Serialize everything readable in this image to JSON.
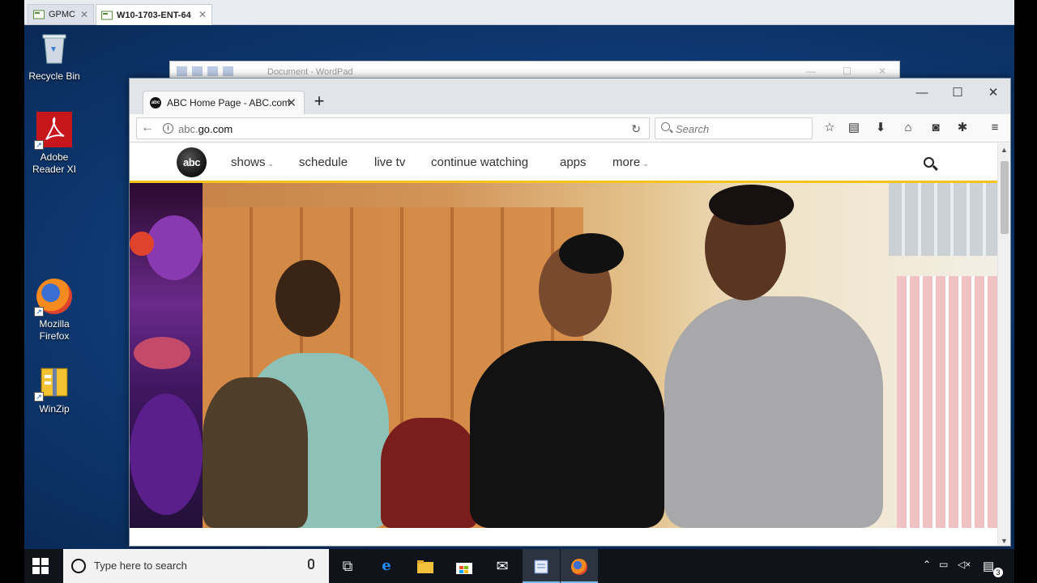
{
  "host_tabs": [
    {
      "label": "GPMC",
      "close": "✕"
    },
    {
      "label": "W10-1703-ENT-64",
      "close": "✕"
    }
  ],
  "desktop_icons": [
    {
      "label_line1": "Recycle Bin",
      "label_line2": ""
    },
    {
      "label_line1": "Adobe",
      "label_line2": "Reader XI"
    },
    {
      "label_line1": "Mozilla",
      "label_line2": "Firefox"
    },
    {
      "label_line1": "WinZip",
      "label_line2": ""
    }
  ],
  "wordpad": {
    "title": "Document - WordPad"
  },
  "firefox": {
    "tab_title": "ABC Home Page - ABC.com",
    "url_prefix": "abc.",
    "url_domain": "go.com",
    "search_placeholder": "Search",
    "favicon_text": "abc"
  },
  "abc_site": {
    "logo_text": "abc",
    "nav": [
      "shows",
      "schedule",
      "live tv",
      "continue watching",
      "apps",
      "more"
    ]
  },
  "taskbar": {
    "search_placeholder": "Type here to search",
    "notification_count": "3"
  },
  "colors": {
    "abc_accent": "#f8c31a",
    "desktop_blue": "#0f3f7c",
    "taskbar": "#10141a"
  }
}
